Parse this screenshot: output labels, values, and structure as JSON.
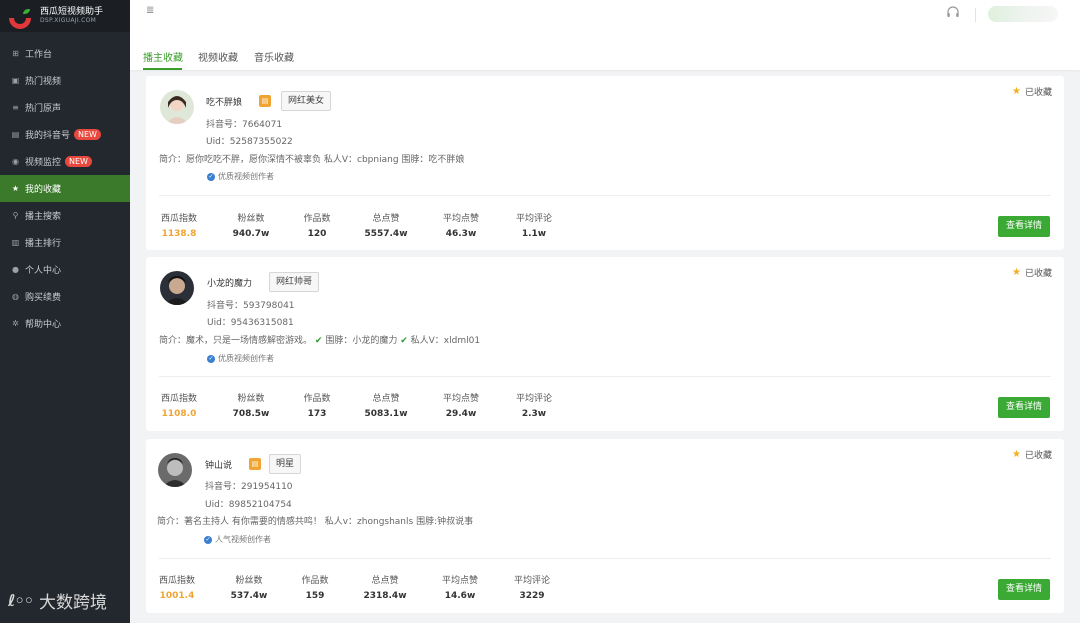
{
  "app": {
    "title": "西瓜短视频助手",
    "subtitle": "DSP.XIGUAJI.COM"
  },
  "sidebar": {
    "items": [
      {
        "label": "工作台",
        "icon": "grid-icon"
      },
      {
        "label": "热门视频",
        "icon": "video-icon"
      },
      {
        "label": "热门原声",
        "icon": "music-list-icon"
      },
      {
        "label": "我的抖音号",
        "icon": "clipboard-icon",
        "badge": "NEW"
      },
      {
        "label": "视频监控",
        "icon": "eye-icon",
        "badge": "NEW"
      },
      {
        "label": "我的收藏",
        "icon": "star-icon",
        "active": true
      },
      {
        "label": "播主搜索",
        "icon": "search-icon"
      },
      {
        "label": "播主排行",
        "icon": "bar-chart-icon"
      },
      {
        "label": "个人中心",
        "icon": "user-icon"
      },
      {
        "label": "购买续费",
        "icon": "coin-icon"
      },
      {
        "label": "帮助中心",
        "icon": "gear-icon"
      }
    ]
  },
  "watermark": {
    "logo": "ℓ◦◦",
    "text": "大数跨境"
  },
  "tabs": [
    "播主收藏",
    "视频收藏",
    "音乐收藏"
  ],
  "stat_labels": [
    "西瓜指数",
    "粉丝数",
    "作品数",
    "总点赞",
    "平均点赞",
    "平均评论"
  ],
  "collected_label": "已收藏",
  "detail_button": "查看详情",
  "cards": [
    {
      "name": "吃不胖娘",
      "gold_badge": "▤",
      "tag": "网红美女",
      "douyin_id": "抖音号：7664071",
      "uid": "Uid：52587355022",
      "intro": "简介：愿你吃吃不胖，愿你深情不被辜负 私人V：cbpniang 围脖：吃不胖娘",
      "verified": "优质视频创作者",
      "stats": [
        "1138.8",
        "940.7w",
        "120",
        "5557.4w",
        "46.3w",
        "1.1w"
      ]
    },
    {
      "name": "小龙的魔力",
      "tag": "网红帅哥",
      "douyin_id": "抖音号：593798041",
      "uid": "Uid：95436315081",
      "intro_a": "简介：魔术，只是一场情感解密游戏。",
      "intro_b": "围脖：小龙的魔力",
      "intro_c": "私人V：xldml01",
      "check": "✔",
      "verified": "优质视频创作者",
      "stats": [
        "1108.0",
        "708.5w",
        "173",
        "5083.1w",
        "29.4w",
        "2.3w"
      ]
    },
    {
      "name": "钟山说",
      "gold_badge": "▤",
      "tag": "明星",
      "douyin_id": "抖音号：291954110",
      "uid": "Uid：89852104754",
      "intro": "简介：著名主持人 有你需要的情感共鸣！ 私人v：zhongshanls 围脖:钟叔说事",
      "verified": "人气视频创作者",
      "stats": [
        "1001.4",
        "537.4w",
        "159",
        "2318.4w",
        "14.6w",
        "3229"
      ]
    }
  ],
  "colors": {
    "brand_green": "#3aaa35",
    "sidebar_bg": "#23282e",
    "active_bg": "#3a7a2a",
    "orange": "#f0a532",
    "badge_red": "#e8483d"
  }
}
